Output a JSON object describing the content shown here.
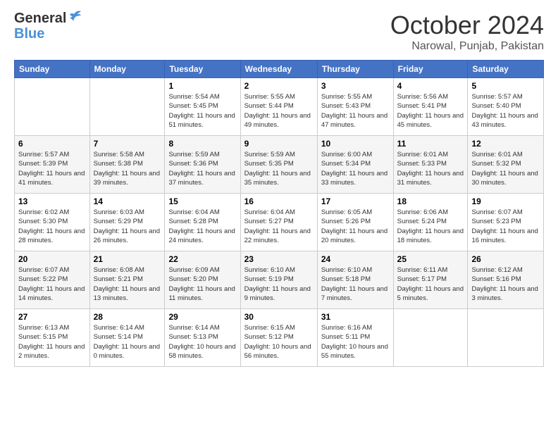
{
  "header": {
    "logo_line1": "General",
    "logo_line2": "Blue",
    "month_title": "October 2024",
    "location": "Narowal, Punjab, Pakistan"
  },
  "weekdays": [
    "Sunday",
    "Monday",
    "Tuesday",
    "Wednesday",
    "Thursday",
    "Friday",
    "Saturday"
  ],
  "weeks": [
    [
      {
        "day": "",
        "sunrise": "",
        "sunset": "",
        "daylight": ""
      },
      {
        "day": "",
        "sunrise": "",
        "sunset": "",
        "daylight": ""
      },
      {
        "day": "1",
        "sunrise": "Sunrise: 5:54 AM",
        "sunset": "Sunset: 5:45 PM",
        "daylight": "Daylight: 11 hours and 51 minutes."
      },
      {
        "day": "2",
        "sunrise": "Sunrise: 5:55 AM",
        "sunset": "Sunset: 5:44 PM",
        "daylight": "Daylight: 11 hours and 49 minutes."
      },
      {
        "day": "3",
        "sunrise": "Sunrise: 5:55 AM",
        "sunset": "Sunset: 5:43 PM",
        "daylight": "Daylight: 11 hours and 47 minutes."
      },
      {
        "day": "4",
        "sunrise": "Sunrise: 5:56 AM",
        "sunset": "Sunset: 5:41 PM",
        "daylight": "Daylight: 11 hours and 45 minutes."
      },
      {
        "day": "5",
        "sunrise": "Sunrise: 5:57 AM",
        "sunset": "Sunset: 5:40 PM",
        "daylight": "Daylight: 11 hours and 43 minutes."
      }
    ],
    [
      {
        "day": "6",
        "sunrise": "Sunrise: 5:57 AM",
        "sunset": "Sunset: 5:39 PM",
        "daylight": "Daylight: 11 hours and 41 minutes."
      },
      {
        "day": "7",
        "sunrise": "Sunrise: 5:58 AM",
        "sunset": "Sunset: 5:38 PM",
        "daylight": "Daylight: 11 hours and 39 minutes."
      },
      {
        "day": "8",
        "sunrise": "Sunrise: 5:59 AM",
        "sunset": "Sunset: 5:36 PM",
        "daylight": "Daylight: 11 hours and 37 minutes."
      },
      {
        "day": "9",
        "sunrise": "Sunrise: 5:59 AM",
        "sunset": "Sunset: 5:35 PM",
        "daylight": "Daylight: 11 hours and 35 minutes."
      },
      {
        "day": "10",
        "sunrise": "Sunrise: 6:00 AM",
        "sunset": "Sunset: 5:34 PM",
        "daylight": "Daylight: 11 hours and 33 minutes."
      },
      {
        "day": "11",
        "sunrise": "Sunrise: 6:01 AM",
        "sunset": "Sunset: 5:33 PM",
        "daylight": "Daylight: 11 hours and 31 minutes."
      },
      {
        "day": "12",
        "sunrise": "Sunrise: 6:01 AM",
        "sunset": "Sunset: 5:32 PM",
        "daylight": "Daylight: 11 hours and 30 minutes."
      }
    ],
    [
      {
        "day": "13",
        "sunrise": "Sunrise: 6:02 AM",
        "sunset": "Sunset: 5:30 PM",
        "daylight": "Daylight: 11 hours and 28 minutes."
      },
      {
        "day": "14",
        "sunrise": "Sunrise: 6:03 AM",
        "sunset": "Sunset: 5:29 PM",
        "daylight": "Daylight: 11 hours and 26 minutes."
      },
      {
        "day": "15",
        "sunrise": "Sunrise: 6:04 AM",
        "sunset": "Sunset: 5:28 PM",
        "daylight": "Daylight: 11 hours and 24 minutes."
      },
      {
        "day": "16",
        "sunrise": "Sunrise: 6:04 AM",
        "sunset": "Sunset: 5:27 PM",
        "daylight": "Daylight: 11 hours and 22 minutes."
      },
      {
        "day": "17",
        "sunrise": "Sunrise: 6:05 AM",
        "sunset": "Sunset: 5:26 PM",
        "daylight": "Daylight: 11 hours and 20 minutes."
      },
      {
        "day": "18",
        "sunrise": "Sunrise: 6:06 AM",
        "sunset": "Sunset: 5:24 PM",
        "daylight": "Daylight: 11 hours and 18 minutes."
      },
      {
        "day": "19",
        "sunrise": "Sunrise: 6:07 AM",
        "sunset": "Sunset: 5:23 PM",
        "daylight": "Daylight: 11 hours and 16 minutes."
      }
    ],
    [
      {
        "day": "20",
        "sunrise": "Sunrise: 6:07 AM",
        "sunset": "Sunset: 5:22 PM",
        "daylight": "Daylight: 11 hours and 14 minutes."
      },
      {
        "day": "21",
        "sunrise": "Sunrise: 6:08 AM",
        "sunset": "Sunset: 5:21 PM",
        "daylight": "Daylight: 11 hours and 13 minutes."
      },
      {
        "day": "22",
        "sunrise": "Sunrise: 6:09 AM",
        "sunset": "Sunset: 5:20 PM",
        "daylight": "Daylight: 11 hours and 11 minutes."
      },
      {
        "day": "23",
        "sunrise": "Sunrise: 6:10 AM",
        "sunset": "Sunset: 5:19 PM",
        "daylight": "Daylight: 11 hours and 9 minutes."
      },
      {
        "day": "24",
        "sunrise": "Sunrise: 6:10 AM",
        "sunset": "Sunset: 5:18 PM",
        "daylight": "Daylight: 11 hours and 7 minutes."
      },
      {
        "day": "25",
        "sunrise": "Sunrise: 6:11 AM",
        "sunset": "Sunset: 5:17 PM",
        "daylight": "Daylight: 11 hours and 5 minutes."
      },
      {
        "day": "26",
        "sunrise": "Sunrise: 6:12 AM",
        "sunset": "Sunset: 5:16 PM",
        "daylight": "Daylight: 11 hours and 3 minutes."
      }
    ],
    [
      {
        "day": "27",
        "sunrise": "Sunrise: 6:13 AM",
        "sunset": "Sunset: 5:15 PM",
        "daylight": "Daylight: 11 hours and 2 minutes."
      },
      {
        "day": "28",
        "sunrise": "Sunrise: 6:14 AM",
        "sunset": "Sunset: 5:14 PM",
        "daylight": "Daylight: 11 hours and 0 minutes."
      },
      {
        "day": "29",
        "sunrise": "Sunrise: 6:14 AM",
        "sunset": "Sunset: 5:13 PM",
        "daylight": "Daylight: 10 hours and 58 minutes."
      },
      {
        "day": "30",
        "sunrise": "Sunrise: 6:15 AM",
        "sunset": "Sunset: 5:12 PM",
        "daylight": "Daylight: 10 hours and 56 minutes."
      },
      {
        "day": "31",
        "sunrise": "Sunrise: 6:16 AM",
        "sunset": "Sunset: 5:11 PM",
        "daylight": "Daylight: 10 hours and 55 minutes."
      },
      {
        "day": "",
        "sunrise": "",
        "sunset": "",
        "daylight": ""
      },
      {
        "day": "",
        "sunrise": "",
        "sunset": "",
        "daylight": ""
      }
    ]
  ]
}
